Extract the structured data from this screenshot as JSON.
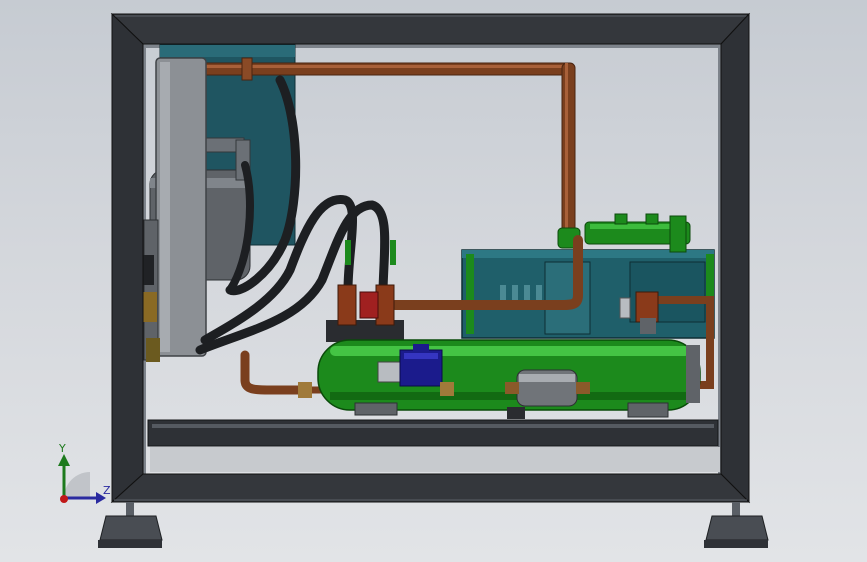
{
  "viewport": {
    "background_top": "#c6cbd2",
    "background_bottom": "#e2e4e7"
  },
  "model": {
    "frame_color": "#2e3136",
    "copper_color": "#7a3f1e",
    "hose_color": "#1d1f22",
    "tank_color": "#1c8a1c",
    "compressor_color": "#1f5f6a",
    "panel_color": "#8c9095",
    "valve_color": "#1b1b8c"
  },
  "triad": {
    "y_label": "Y",
    "z_label": "Z",
    "y_color": "#1d7a1d",
    "z_color": "#2a2aa0",
    "x_color": "#c01818"
  }
}
